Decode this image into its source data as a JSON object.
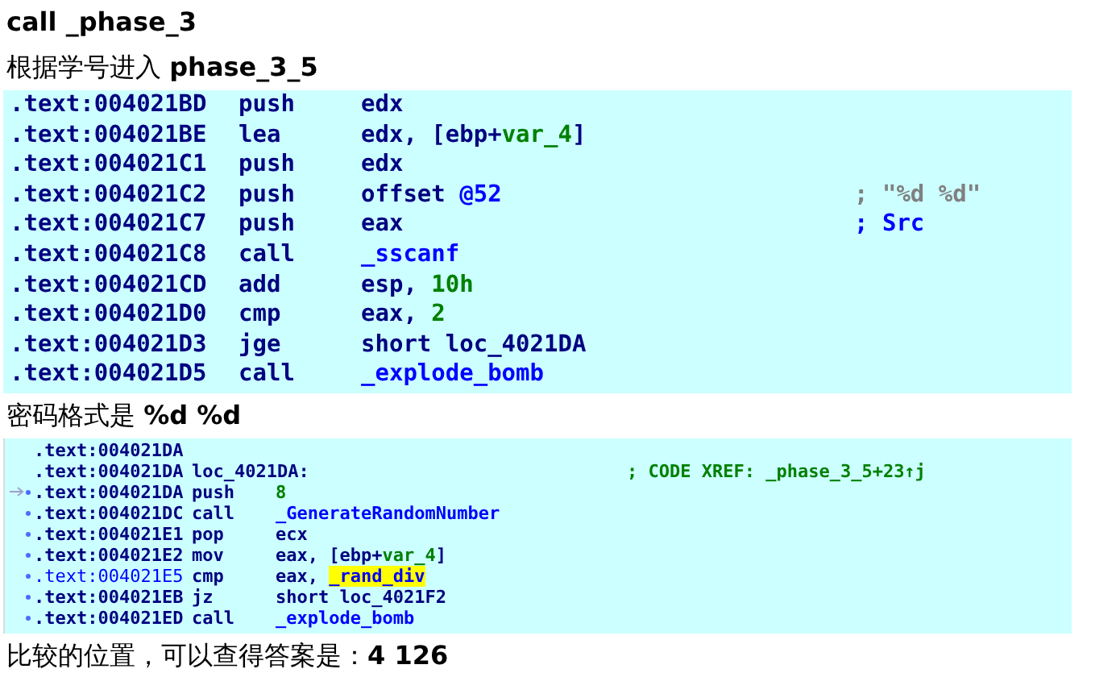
{
  "sections": [
    {
      "kind": "heading",
      "bold": true,
      "text": "call _phase_3"
    },
    {
      "kind": "heading",
      "bold": false,
      "text": "根据学号进入 **phase_3_5**"
    },
    {
      "kind": "listing_large",
      "lines": [
        {
          "kind": "instr",
          "address": ".text:004021BD",
          "mnemonic": "push",
          "operands": [
            {
              "t": "edx",
              "kind": "reg"
            }
          ]
        },
        {
          "kind": "instr",
          "address": ".text:004021BE",
          "mnemonic": "lea",
          "operands": [
            {
              "t": "edx, [ebp+",
              "kind": "reg"
            },
            {
              "t": "var_4",
              "kind": "var"
            },
            {
              "t": "]",
              "kind": "reg"
            }
          ]
        },
        {
          "kind": "instr",
          "address": ".text:004021C1",
          "mnemonic": "push",
          "operands": [
            {
              "t": "edx",
              "kind": "reg"
            }
          ]
        },
        {
          "kind": "instr",
          "address": ".text:004021C2",
          "mnemonic": "push",
          "operands": [
            {
              "t": "offset ",
              "kind": "reg"
            },
            {
              "t": "@52",
              "kind": "name"
            }
          ],
          "comment": [
            {
              "t": "; \"%d %d\"",
              "kind": "string"
            }
          ]
        },
        {
          "kind": "instr",
          "address": ".text:004021C7",
          "mnemonic": "push",
          "operands": [
            {
              "t": "eax",
              "kind": "reg"
            }
          ],
          "comment": [
            {
              "t": "; Src",
              "kind": "name"
            }
          ]
        },
        {
          "kind": "instr",
          "address": ".text:004021C8",
          "mnemonic": "call",
          "operands": [
            {
              "t": "_sscanf",
              "kind": "name"
            }
          ]
        },
        {
          "kind": "instr",
          "address": ".text:004021CD",
          "mnemonic": "add",
          "operands": [
            {
              "t": "esp, ",
              "kind": "reg"
            },
            {
              "t": "10h",
              "kind": "number"
            }
          ]
        },
        {
          "kind": "instr",
          "address": ".text:004021D0",
          "mnemonic": "cmp",
          "operands": [
            {
              "t": "eax, ",
              "kind": "reg"
            },
            {
              "t": "2",
              "kind": "number"
            }
          ]
        },
        {
          "kind": "instr",
          "address": ".text:004021D3",
          "mnemonic": "jge",
          "operands": [
            {
              "t": "short loc_4021DA",
              "kind": "reg"
            }
          ]
        },
        {
          "kind": "instr",
          "address": ".text:004021D5",
          "mnemonic": "call",
          "operands": [
            {
              "t": "_explode_bomb",
              "kind": "name"
            }
          ]
        }
      ]
    },
    {
      "kind": "heading",
      "bold": false,
      "text": "密码格式是 **%d %d**"
    },
    {
      "kind": "listing_small",
      "lines": [
        {
          "kind": "bare",
          "bullet": false,
          "arrow": false,
          "current": false,
          "address": ".text:004021DA"
        },
        {
          "kind": "label",
          "bullet": false,
          "arrow": false,
          "current": false,
          "address": ".text:004021DA",
          "mnemonic": "loc_4021DA:",
          "comment": [
            {
              "t": "; CODE XREF: _phase_3_5+23↑j",
              "kind": "number"
            }
          ]
        },
        {
          "kind": "instr",
          "bullet": true,
          "arrow": true,
          "current": false,
          "address": ".text:004021DA",
          "mnemonic": "push",
          "operands": [
            {
              "t": "8",
              "kind": "number"
            }
          ]
        },
        {
          "kind": "instr",
          "bullet": true,
          "arrow": false,
          "current": false,
          "address": ".text:004021DC",
          "mnemonic": "call",
          "operands": [
            {
              "t": "_GenerateRandomNumber",
              "kind": "name"
            }
          ]
        },
        {
          "kind": "instr",
          "bullet": true,
          "arrow": false,
          "current": false,
          "address": ".text:004021E1",
          "mnemonic": "pop",
          "operands": [
            {
              "t": "ecx",
              "kind": "reg"
            }
          ]
        },
        {
          "kind": "instr",
          "bullet": true,
          "arrow": false,
          "current": false,
          "address": ".text:004021E2",
          "mnemonic": "mov",
          "operands": [
            {
              "t": "eax, [ebp+",
              "kind": "reg"
            },
            {
              "t": "var_4",
              "kind": "var"
            },
            {
              "t": "]",
              "kind": "reg"
            }
          ]
        },
        {
          "kind": "instr",
          "bullet": true,
          "arrow": false,
          "current": true,
          "address": ".text:004021E5",
          "mnemonic": "cmp",
          "operands": [
            {
              "t": "eax, ",
              "kind": "reg"
            },
            {
              "t": "_rand_div",
              "kind": "highlight"
            }
          ]
        },
        {
          "kind": "instr",
          "bullet": true,
          "arrow": false,
          "current": false,
          "address": ".text:004021EB",
          "mnemonic": "jz",
          "operands": [
            {
              "t": "short loc_4021F2",
              "kind": "reg"
            }
          ]
        },
        {
          "kind": "instr",
          "bullet": true,
          "arrow": false,
          "current": false,
          "address": ".text:004021ED",
          "mnemonic": "call",
          "operands": [
            {
              "t": "_explode_bomb",
              "kind": "name"
            }
          ]
        }
      ]
    },
    {
      "kind": "heading",
      "bold": false,
      "text": "比较的位置，可以查得答案是：**4 126**"
    }
  ]
}
